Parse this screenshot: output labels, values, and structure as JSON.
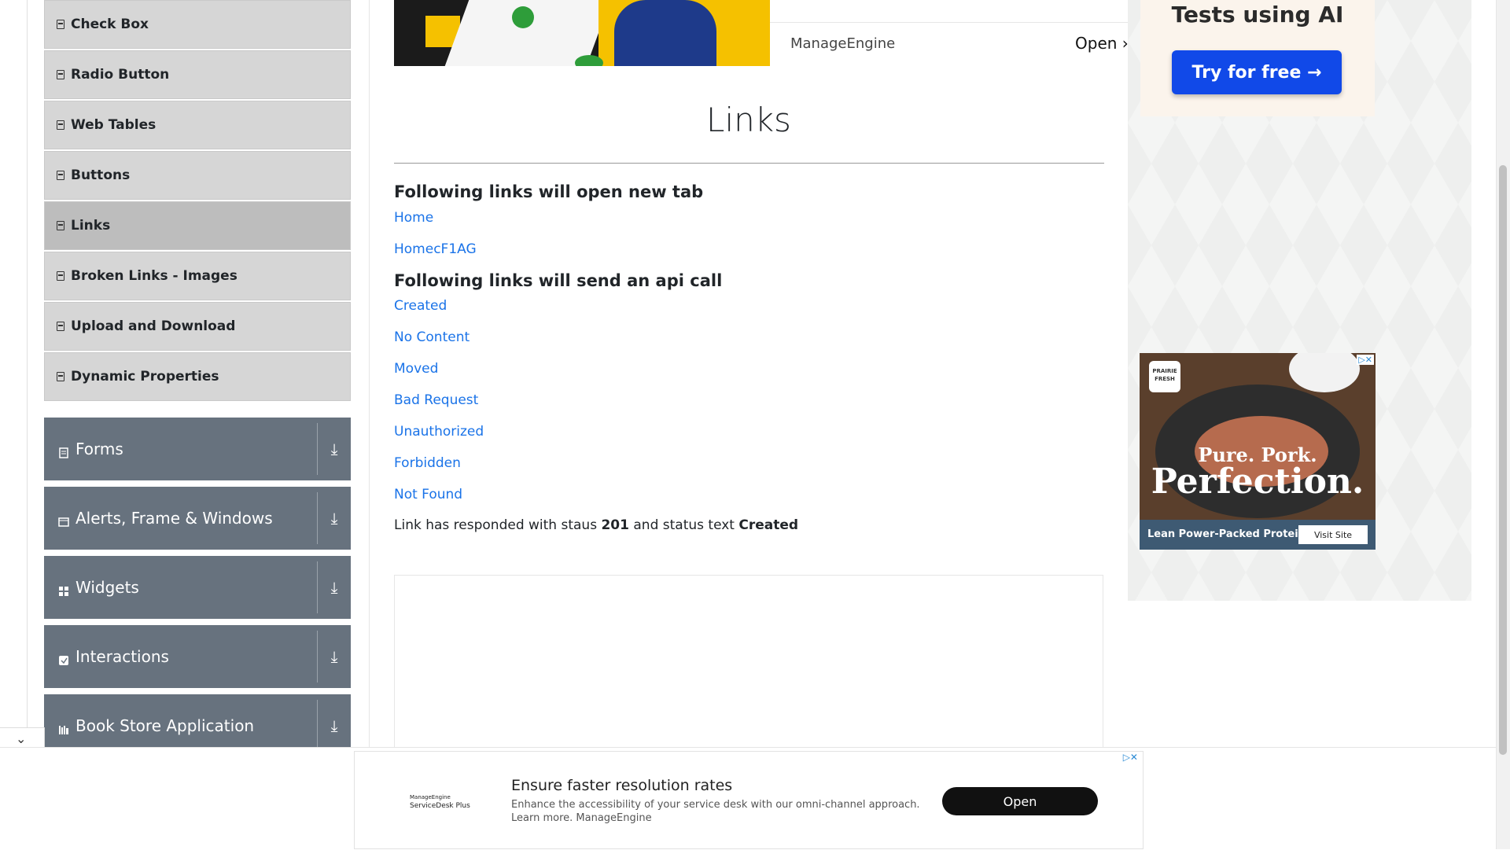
{
  "sidebar": {
    "items": [
      {
        "label": "Check Box"
      },
      {
        "label": "Radio Button"
      },
      {
        "label": "Web Tables"
      },
      {
        "label": "Buttons"
      },
      {
        "label": "Links",
        "active": true
      },
      {
        "label": "Broken Links - Images"
      },
      {
        "label": "Upload and Download"
      },
      {
        "label": "Dynamic Properties"
      }
    ],
    "groups": [
      {
        "label": "Forms",
        "icon": "form-icon"
      },
      {
        "label": "Alerts, Frame & Windows",
        "icon": "window-icon"
      },
      {
        "label": "Widgets",
        "icon": "widgets-icon"
      },
      {
        "label": "Interactions",
        "icon": "interactions-icon"
      },
      {
        "label": "Book Store Application",
        "icon": "bookstore-icon"
      }
    ],
    "collapse_icon": "chevron-down-icon"
  },
  "top_ad": {
    "advertiser": "ManageEngine",
    "open_label": "Open"
  },
  "main": {
    "title": "Links",
    "new_tab_heading": "Following links will open new tab",
    "new_tab_links": [
      "Home",
      "HomecF1AG"
    ],
    "api_heading": "Following links will send an api call",
    "api_links": [
      "Created",
      "No Content",
      "Moved",
      "Bad Request",
      "Unauthorized",
      "Forbidden",
      "Not Found"
    ],
    "response": {
      "prefix": "Link has responded with staus",
      "status_code": "201",
      "middle": "and status text",
      "status_text": "Created"
    }
  },
  "right_ads": {
    "ai_card": {
      "text": "Tests using AI",
      "button_label": "Try for free →",
      "button_color": "#1149e8"
    },
    "pork_ad": {
      "brand": "PRAIRIE FRESH",
      "tagline": "Pure. Pork.",
      "headline": "Perfection.",
      "footer_text": "Lean Power-Packed Protein",
      "visit_label": "Visit Site"
    }
  },
  "bottom_ad": {
    "logo_line1": "ManageEngine",
    "logo_line2": "ServiceDesk Plus",
    "title": "Ensure faster resolution rates",
    "description": "Enhance the accessibility of your service desk with our omni-channel approach. Learn more. ManageEngine",
    "open_label": "Open"
  },
  "colors": {
    "link": "#1a73e8",
    "sidebar_group_bg": "#67727e",
    "sidebar_item_bg": "#d6d6d6",
    "sidebar_active_bg": "#bdbdbd"
  }
}
